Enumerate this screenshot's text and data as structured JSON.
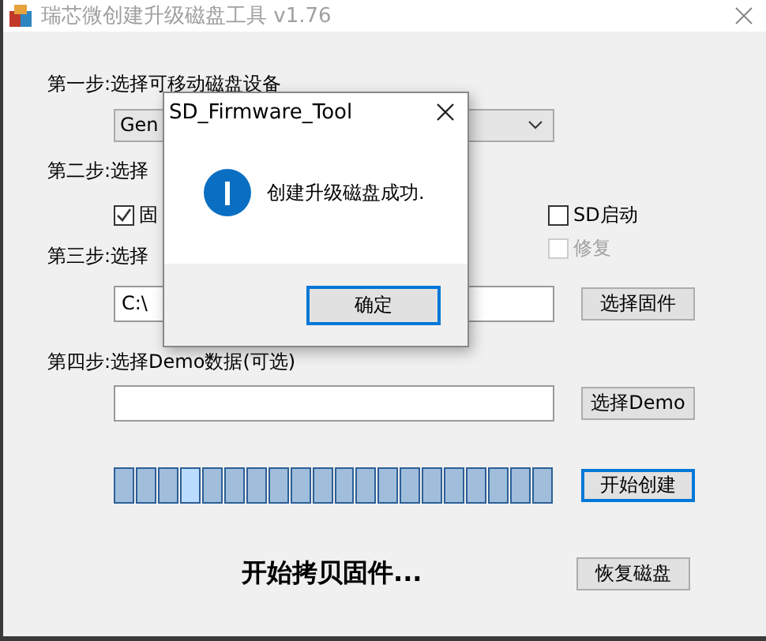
{
  "window": {
    "title": "瑞芯微创建升级磁盘工具 v1.76"
  },
  "step1": {
    "label": "第一步:选择可移动磁盘设备",
    "device": "Gen"
  },
  "step2": {
    "label": "第二步:选择",
    "options": [
      {
        "label": "固",
        "checked": true,
        "disabled": false
      },
      {
        "label": "SD启动",
        "checked": false,
        "disabled": false
      },
      {
        "label": "修复",
        "checked": false,
        "disabled": true
      }
    ]
  },
  "step3": {
    "label": "第三步:选择",
    "path": "C:\\",
    "button": "选择固件"
  },
  "step4": {
    "label": "第四步:选择Demo数据(可选)",
    "button": "选择Demo"
  },
  "progress": {
    "segments": [
      {
        "lit": false
      },
      {
        "lit": false
      },
      {
        "lit": false
      },
      {
        "lit": true
      },
      {
        "lit": false
      },
      {
        "lit": false
      },
      {
        "lit": false
      },
      {
        "lit": false
      },
      {
        "lit": false
      },
      {
        "lit": false
      },
      {
        "lit": false
      },
      {
        "lit": false
      },
      {
        "lit": false
      },
      {
        "lit": false
      },
      {
        "lit": false
      },
      {
        "lit": false
      },
      {
        "lit": false
      },
      {
        "lit": false
      },
      {
        "lit": false
      },
      {
        "lit": false
      }
    ],
    "button": "开始创建"
  },
  "status": "开始拷贝固件...",
  "restore_button": "恢复磁盘",
  "dialog": {
    "title": "SD_Firmware_Tool",
    "message": "创建升级磁盘成功.",
    "ok": "确定"
  }
}
